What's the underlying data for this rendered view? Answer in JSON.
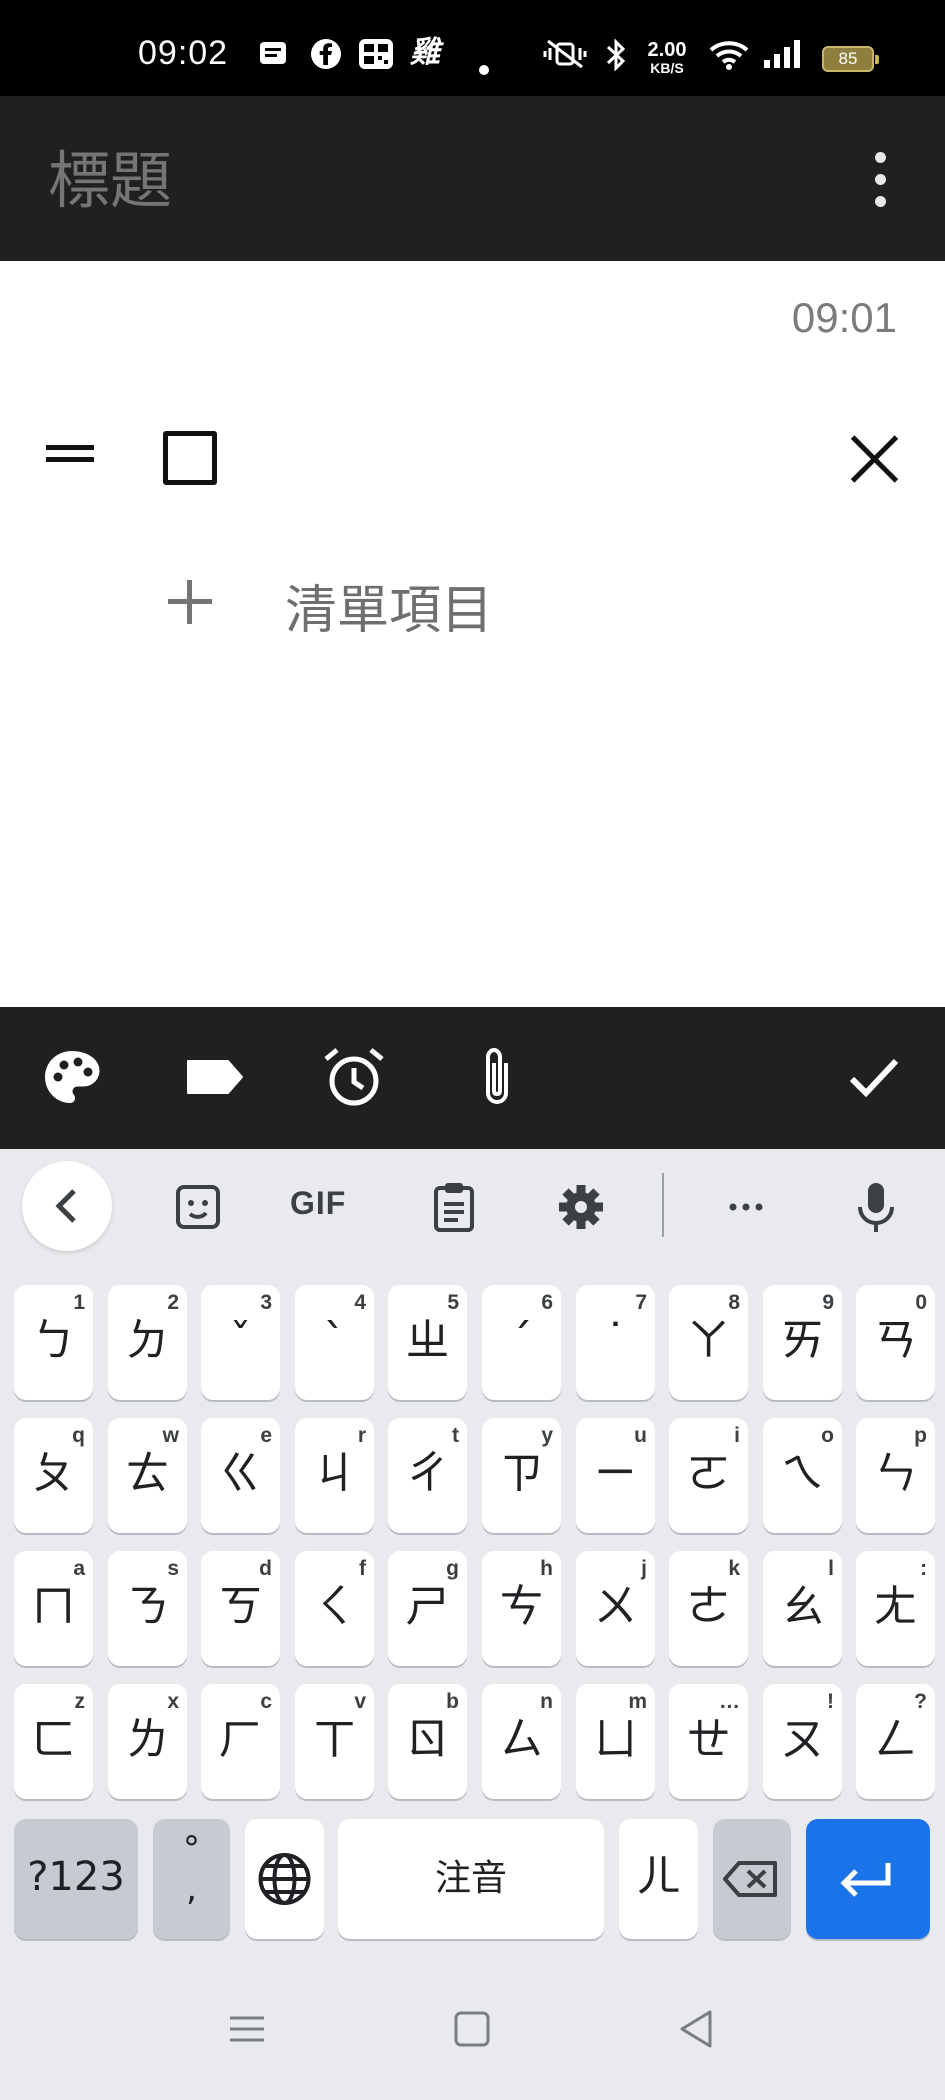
{
  "status_bar": {
    "time": "09:02",
    "net_speed_value": "2.00",
    "net_speed_unit": "KB/S",
    "battery": "85",
    "icons": [
      "notes-icon",
      "facebook-icon",
      "qr-icon",
      "chicken-icon",
      "dot-icon",
      "mute-vibrate-icon",
      "bluetooth-icon",
      "wifi-icon",
      "signal-icon",
      "battery-icon"
    ]
  },
  "app_bar": {
    "title": "標題",
    "menu_icon": "more-vert-icon"
  },
  "note": {
    "edited_time": "09:01",
    "item_text": "",
    "add_item_label": "清單項目"
  },
  "note_toolbar": {
    "icons": [
      "palette-icon",
      "label-icon",
      "alarm-icon",
      "attach-icon",
      "done-check-icon"
    ]
  },
  "keyboard": {
    "toolbar": {
      "gif_label": "GIF",
      "icons": [
        "back-chevron-icon",
        "sticker-icon",
        "clipboard-icon",
        "settings-gear-icon",
        "more-horiz-icon",
        "mic-icon"
      ]
    },
    "rows": [
      [
        {
          "main": "ㄅ",
          "sub": "1"
        },
        {
          "main": "ㄉ",
          "sub": "2"
        },
        {
          "main": "ˇ",
          "sub": "3"
        },
        {
          "main": "ˋ",
          "sub": "4"
        },
        {
          "main": "ㄓ",
          "sub": "5"
        },
        {
          "main": "ˊ",
          "sub": "6"
        },
        {
          "main": "˙",
          "sub": "7"
        },
        {
          "main": "ㄚ",
          "sub": "8"
        },
        {
          "main": "ㄞ",
          "sub": "9"
        },
        {
          "main": "ㄢ",
          "sub": "0"
        }
      ],
      [
        {
          "main": "ㄆ",
          "sub": "q"
        },
        {
          "main": "ㄊ",
          "sub": "w"
        },
        {
          "main": "ㄍ",
          "sub": "e"
        },
        {
          "main": "ㄐ",
          "sub": "r"
        },
        {
          "main": "ㄔ",
          "sub": "t"
        },
        {
          "main": "ㄗ",
          "sub": "y"
        },
        {
          "main": "ㄧ",
          "sub": "u"
        },
        {
          "main": "ㄛ",
          "sub": "i"
        },
        {
          "main": "ㄟ",
          "sub": "o"
        },
        {
          "main": "ㄣ",
          "sub": "p"
        }
      ],
      [
        {
          "main": "ㄇ",
          "sub": "a"
        },
        {
          "main": "ㄋ",
          "sub": "s"
        },
        {
          "main": "ㄎ",
          "sub": "d"
        },
        {
          "main": "ㄑ",
          "sub": "f"
        },
        {
          "main": "ㄕ",
          "sub": "g"
        },
        {
          "main": "ㄘ",
          "sub": "h"
        },
        {
          "main": "ㄨ",
          "sub": "j"
        },
        {
          "main": "ㄜ",
          "sub": "k"
        },
        {
          "main": "ㄠ",
          "sub": "l"
        },
        {
          "main": "ㄤ",
          "sub": ":"
        }
      ],
      [
        {
          "main": "ㄈ",
          "sub": "z"
        },
        {
          "main": "ㄌ",
          "sub": "x"
        },
        {
          "main": "ㄏ",
          "sub": "c"
        },
        {
          "main": "ㄒ",
          "sub": "v"
        },
        {
          "main": "ㄖ",
          "sub": "b"
        },
        {
          "main": "ㄙ",
          "sub": "n"
        },
        {
          "main": "ㄩ",
          "sub": "m"
        },
        {
          "main": "ㄝ",
          "sub": "…"
        },
        {
          "main": "ㄡ",
          "sub": "!"
        },
        {
          "main": "ㄥ",
          "sub": "?"
        }
      ]
    ],
    "bottom_row": {
      "symbols_label": "?123",
      "punct_top": "°",
      "punct_bottom": ",",
      "space_label": "注音",
      "er_key": "ㄦ",
      "globe_icon": "globe-icon",
      "backspace_icon": "backspace-icon",
      "enter_icon": "enter-icon"
    },
    "colors": {
      "background": "#e8eaed",
      "key": "#ffffff",
      "mod_key": "#c7cbd1",
      "enter": "#1a73e8"
    }
  },
  "nav_bar": {
    "icons": [
      "recents-icon",
      "home-icon",
      "back-icon"
    ]
  }
}
